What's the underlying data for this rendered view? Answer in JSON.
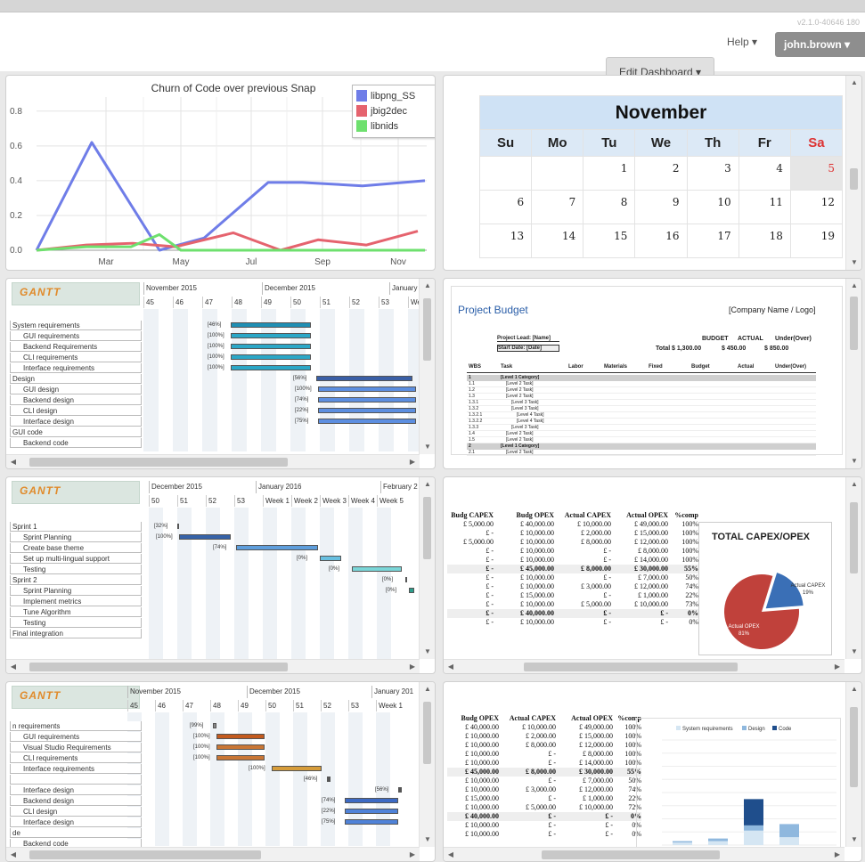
{
  "header": {
    "version": "v2.1.0-40646 180",
    "edit_dashboard": "Edit Dashboard",
    "help": "Help",
    "user": "john.brown"
  },
  "churn": {
    "chart_data": {
      "type": "line",
      "title": "Churn of Code over previous Snap",
      "x_ticks": [
        "Mar",
        "May",
        "Jul",
        "Sep",
        "Nov"
      ],
      "y_ticks": [
        "0.0",
        "0.2",
        "0.4",
        "0.6",
        "0.8"
      ],
      "ylim": [
        0,
        0.85
      ],
      "series": [
        {
          "name": "libpng_SS",
          "color": "#6f7de8",
          "values": [
            0.0,
            0.62,
            0.0,
            0.07,
            0.39,
            0.39,
            0.37,
            0.4
          ]
        },
        {
          "name": "jbig2dec",
          "color": "#e5636e",
          "values": [
            0.0,
            0.03,
            0.04,
            0.02,
            0.1,
            0.0,
            0.06,
            0.03,
            0.11
          ]
        },
        {
          "name": "libnids",
          "color": "#6ee06e",
          "values": [
            0.0,
            0.02,
            0.02,
            0.09,
            0.0,
            0.0,
            0.0,
            0.0
          ]
        }
      ],
      "legend_position": "top-right"
    }
  },
  "calendar": {
    "month": "November",
    "days_of_week": [
      "Su",
      "Mo",
      "Tu",
      "We",
      "Th",
      "Fr",
      "Sa"
    ],
    "weeks": [
      [
        "",
        "",
        "1",
        "2",
        "3",
        "4",
        "5"
      ],
      [
        "6",
        "7",
        "8",
        "9",
        "10",
        "11",
        "12"
      ],
      [
        "13",
        "14",
        "15",
        "16",
        "17",
        "18",
        "19"
      ]
    ]
  },
  "gantt1": {
    "logo": "GANTT",
    "months": [
      "November 2015",
      "December 2015",
      "January"
    ],
    "weeks": [
      "45",
      "46",
      "47",
      "48",
      "49",
      "50",
      "51",
      "52",
      "53",
      "We"
    ],
    "tasks": [
      "System requirements",
      "GUI requirements",
      "Backend Requirements",
      "CLI requirements",
      "Interface requirements",
      "Design",
      "GUI design",
      "Backend design",
      "CLI design",
      "Interface design",
      "GUI code",
      "Backend code"
    ],
    "pcts": [
      "[46%]",
      "[100%]",
      "[100%]",
      "[100%]",
      "[100%]",
      "[56%]",
      "[100%]",
      "[74%]",
      "[22%]",
      "[75%]"
    ]
  },
  "budget": {
    "title": "Project Budget",
    "company": "[Company Name / Logo]",
    "lead": "Project Lead: [Name]",
    "start": "Start Date: [Date]",
    "headers": [
      "BUDGET",
      "ACTUAL",
      "Under(Over)"
    ],
    "total": [
      "Total",
      "$ 1,300.00",
      "$ 450.00",
      "$ 850.00"
    ],
    "cols": [
      "WBS",
      "Task",
      "Labor",
      "Materials",
      "Fixed",
      "Budget",
      "Actual",
      "Under(Over)"
    ],
    "rows": [
      [
        "1",
        "[Level 1 Category]"
      ],
      [
        "1.1",
        "[Level 2 Task]"
      ],
      [
        "1.2",
        "[Level 2 Task]"
      ],
      [
        "1.3",
        "[Level 2 Task]"
      ],
      [
        "1.3.1",
        "[Level 3 Task]"
      ],
      [
        "1.3.2",
        "[Level 3 Task]"
      ],
      [
        "1.3.2.1",
        "[Level 4 Task]"
      ],
      [
        "1.3.2.2",
        "[Level 4 Task]"
      ],
      [
        "1.3.3",
        "[Level 3 Task]"
      ],
      [
        "1.4",
        "[Level 2 Task]"
      ],
      [
        "1.5",
        "[Level 2 Task]"
      ],
      [
        "2",
        "[Level 1 Category]"
      ],
      [
        "2.1",
        "[Level 2 Task]"
      ]
    ]
  },
  "gantt2": {
    "logo": "GANTT",
    "months": [
      "December 2015",
      "January 2016",
      "February 2"
    ],
    "weeks": [
      "50",
      "51",
      "52",
      "53",
      "Week 1",
      "Week 2",
      "Week 3",
      "Week 4",
      "Week 5"
    ],
    "tasks": [
      "Sprint 1",
      "Sprint Planning",
      "Create base theme",
      "Set up multi-lingual support",
      "Testing",
      "Sprint 2",
      "Sprint Planning",
      "Implement metrics",
      "Tune Algorithm",
      "Testing",
      "Final integration"
    ],
    "pcts": [
      "[32%]",
      "[100%]",
      "[74%]",
      "[0%]",
      "[0%]",
      "[0%]",
      "[0%]"
    ]
  },
  "capex": {
    "headers": [
      "Budg CAPEX",
      "Budg OPEX",
      "Actual CAPEX",
      "Actual OPEX",
      "%comp"
    ],
    "rows": [
      [
        "£ 5,000.00",
        "£ 40,000.00",
        "£ 10,000.00",
        "£ 49,000.00",
        "100%"
      ],
      [
        "£ -",
        "£ 10,000.00",
        "£ 2,000.00",
        "£ 15,000.00",
        "100%"
      ],
      [
        "£ 5,000.00",
        "£ 10,000.00",
        "£ 8,000.00",
        "£ 12,000.00",
        "100%"
      ],
      [
        "£ -",
        "£ 10,000.00",
        "£ -",
        "£ 8,000.00",
        "100%"
      ],
      [
        "£ -",
        "£ 10,000.00",
        "£ -",
        "£ 14,000.00",
        "100%"
      ],
      [
        "£ -",
        "£ 45,000.00",
        "£ 8,000.00",
        "£ 30,000.00",
        "55%"
      ],
      [
        "£ -",
        "£ 10,000.00",
        "£ -",
        "£ 7,000.00",
        "50%"
      ],
      [
        "£ -",
        "£ 10,000.00",
        "£ 3,000.00",
        "£ 12,000.00",
        "74%"
      ],
      [
        "£ -",
        "£ 15,000.00",
        "£ -",
        "£ 1,000.00",
        "22%"
      ],
      [
        "£ -",
        "£ 10,000.00",
        "£ 5,000.00",
        "£ 10,000.00",
        "73%"
      ],
      [
        "£ -",
        "£ 40,000.00",
        "£ -",
        "£ -",
        "0%"
      ],
      [
        "£ -",
        "£ 10,000.00",
        "£ -",
        "£ -",
        "0%"
      ]
    ],
    "chart_data": {
      "type": "pie",
      "title": "TOTAL CAPEX/OPEX",
      "slices": [
        {
          "label": "Actual CAPEX",
          "pct": "19%",
          "value": 19,
          "color": "#3a6fb6"
        },
        {
          "label": "Actual OPEX",
          "pct": "81%",
          "value": 81,
          "color": "#c0413b"
        }
      ]
    }
  },
  "gantt3": {
    "logo": "GANTT",
    "months": [
      "November 2015",
      "December 2015",
      "January 201"
    ],
    "weeks": [
      "45",
      "46",
      "47",
      "48",
      "49",
      "50",
      "51",
      "52",
      "53",
      "Week 1"
    ],
    "tasks": [
      "n requirements",
      "GUI requirements",
      "Visual Studio Requirements",
      "CLI requirements",
      "Interface requirements",
      "",
      "Interface design",
      "Backend design",
      "CLI design",
      "Interface design",
      "de",
      "Backend code"
    ],
    "pcts": [
      "[99%]",
      "[100%]",
      "[100%]",
      "[100%]",
      "[100%]",
      "[46%]",
      "[56%]",
      "[74%]",
      "[22%]",
      "[75%]"
    ]
  },
  "opex": {
    "headers": [
      "Budg OPEX",
      "Actual CAPEX",
      "Actual OPEX",
      "%comp"
    ],
    "rows": [
      [
        "£ 40,000.00",
        "£ 10,000.00",
        "£ 49,000.00",
        "100%"
      ],
      [
        "£ 10,000.00",
        "£ 2,000.00",
        "£ 15,000.00",
        "100%"
      ],
      [
        "£ 10,000.00",
        "£ 8,000.00",
        "£ 12,000.00",
        "100%"
      ],
      [
        "£ 10,000.00",
        "£ -",
        "£ 8,000.00",
        "100%"
      ],
      [
        "£ 10,000.00",
        "£ -",
        "£ 14,000.00",
        "100%"
      ],
      [
        "£ 45,000.00",
        "£ 8,000.00",
        "£ 30,000.00",
        "55%"
      ],
      [
        "£ 10,000.00",
        "£ -",
        "£ 7,000.00",
        "50%"
      ],
      [
        "£ 10,000.00",
        "£ 3,000.00",
        "£ 12,000.00",
        "74%"
      ],
      [
        "£ 15,000.00",
        "£ -",
        "£ 1,000.00",
        "22%"
      ],
      [
        "£ 10,000.00",
        "£ 5,000.00",
        "£ 10,000.00",
        "72%"
      ],
      [
        "£ 40,000.00",
        "£ -",
        "£ -",
        "0%"
      ],
      [
        "£ 10,000.00",
        "£ -",
        "£ -",
        "0%"
      ],
      [
        "£ 10,000.00",
        "£ -",
        "£ -",
        "0%"
      ]
    ],
    "chart_data": {
      "type": "bar",
      "stacked": true,
      "categories": [
        "System requirements",
        "Design",
        "Code"
      ],
      "legend": [
        "System requirements",
        "Design",
        "Code"
      ],
      "series_colors": [
        "#d5e6f3",
        "#8fb8de",
        "#1f4e8c"
      ],
      "stacks": [
        [
          6,
          2,
          0
        ],
        [
          10,
          4,
          0
        ],
        [
          70,
          48,
          40
        ],
        [
          32,
          20,
          0
        ]
      ],
      "ylim": [
        0,
        160
      ]
    }
  }
}
